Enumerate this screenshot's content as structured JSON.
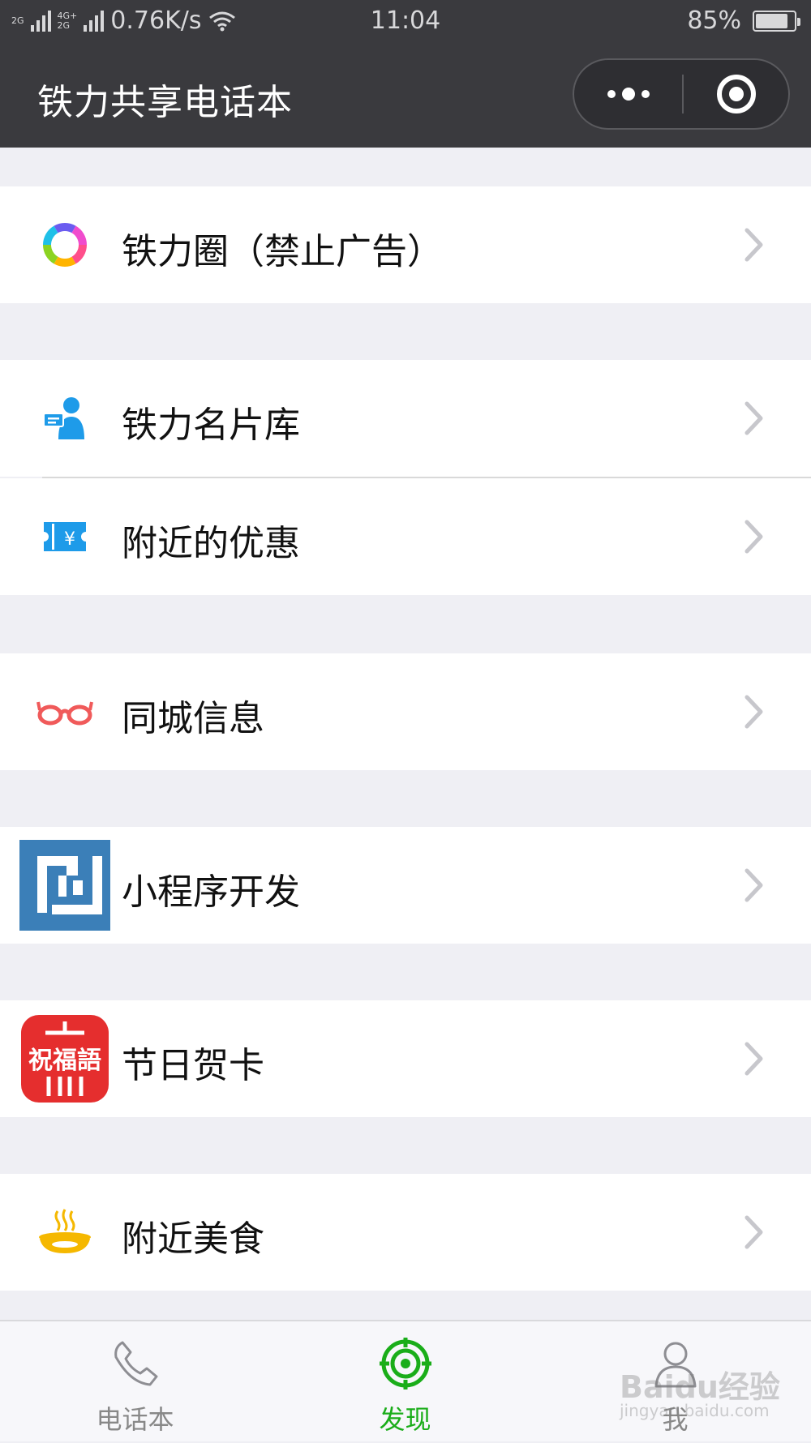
{
  "status_bar": {
    "net_tag_1": "2G",
    "net_tag_2a": "4G+",
    "net_tag_2b": "2G",
    "speed": "0.76K/s",
    "time": "11:04",
    "battery_percent": "85%",
    "battery_level": 0.85
  },
  "nav": {
    "title": "铁力共享电话本"
  },
  "menu": {
    "items": [
      {
        "label": "铁力圈（禁止广告）",
        "icon": "colorful-ring-icon"
      },
      {
        "label": "铁力名片库",
        "icon": "business-card-person-icon"
      },
      {
        "label": "附近的优惠",
        "icon": "coupon-icon"
      },
      {
        "label": "同城信息",
        "icon": "glasses-icon"
      },
      {
        "label": "小程序开发",
        "icon": "mini-program-logo-icon"
      },
      {
        "label": "节日贺卡",
        "icon": "blessing-seal-icon"
      },
      {
        "label": "附近美食",
        "icon": "food-bowl-icon"
      }
    ]
  },
  "seal_text": "祝福語",
  "tab_bar": {
    "tabs": [
      {
        "label": "电话本",
        "icon": "phone-icon"
      },
      {
        "label": "发现",
        "icon": "discover-target-icon",
        "active": true
      },
      {
        "label": "我",
        "icon": "person-icon"
      }
    ]
  },
  "watermark": {
    "text": "Baidu经验",
    "sub": "jingyan.baidu.com"
  },
  "colors": {
    "header_bg": "#3a3a3e",
    "page_bg": "#efeff4",
    "active_tab": "#1aad19"
  }
}
